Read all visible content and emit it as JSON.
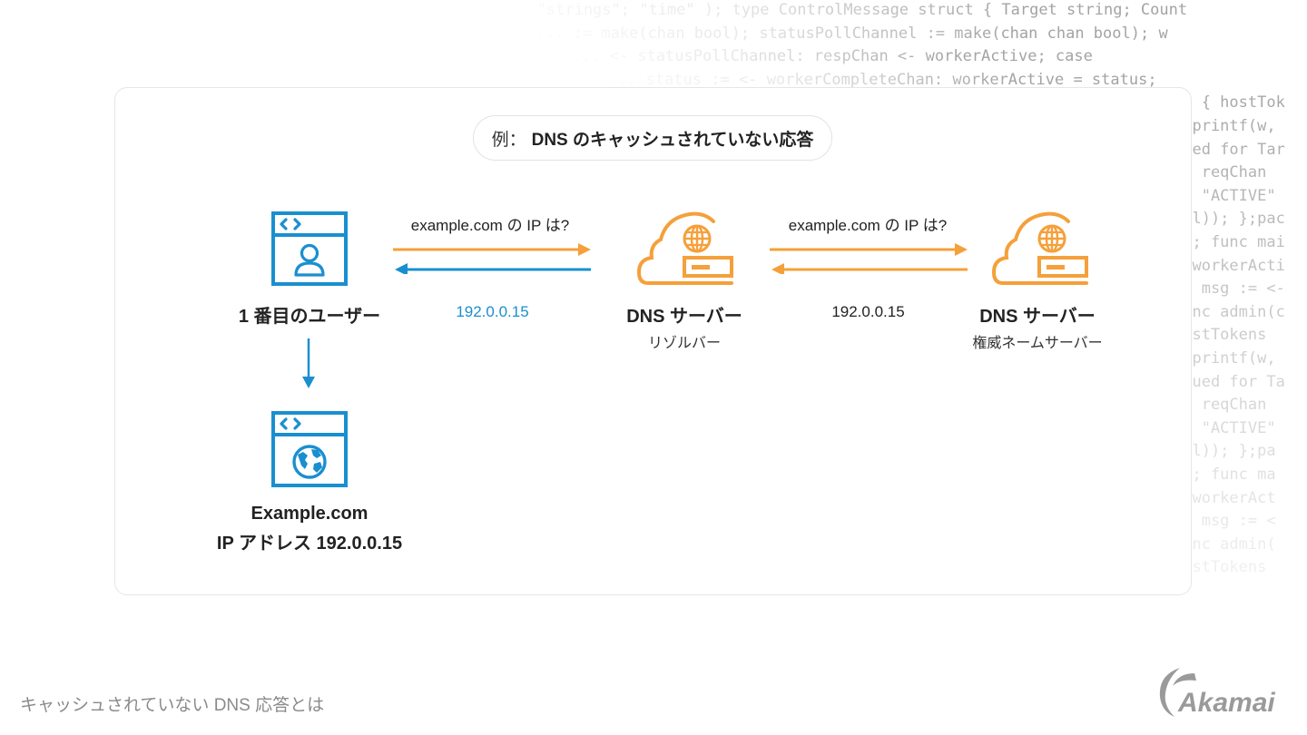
{
  "background_code": [
    "  ...  \"strings\"; \"time\" ); type ControlMessage struct { Target string; Count",
    "   ... := make(chan bool); statusPollChannel := make(chan chan bool); w",
    "   ... <- statusPollChannel: respChan <- workerActive; case",
    "   ... status := <- workerCompleteChan: workerActive = status;",
    "t) { hostTok",
    ".Fprintf(w,",
    "sued for Tar",
    " { reqChan",
    "w, \"ACTIVE\"",
    "nil)); };pac",
    " ); func mai",
    "; workerActi",
    "se msg := <-",
    "func admin(c",
    "hostTokens",
    ".Fprintf(w,",
    "ssued for Ta",
    " { reqChan",
    "w, \"ACTIVE\"",
    "nil)); };pa",
    " ); func ma",
    "; workerAct",
    "se msg := <",
    "func admin(",
    "hostTokens"
  ],
  "diagram": {
    "example_prefix": "例：",
    "example_title": "DNS のキャッシュされていない応答",
    "user": {
      "label": "1 番目のユーザー",
      "icon": "browser-user-icon"
    },
    "resolver": {
      "label": "DNS サーバー",
      "sublabel": "リゾルバー",
      "icon": "cloud-dns-server-icon"
    },
    "authoritative": {
      "label": "DNS サーバー",
      "sublabel": "権威ネームサーバー",
      "icon": "cloud-dns-server-icon"
    },
    "website": {
      "label_line1": "Example.com",
      "label_line2": "IP アドレス 192.0.0.15",
      "icon": "browser-globe-icon"
    },
    "query_user_to_resolver": "example.com の IP は?",
    "reply_resolver_to_user": "192.0.0.15",
    "query_resolver_to_auth": "example.com の IP は?",
    "reply_auth_to_resolver": "192.0.0.15"
  },
  "footer": {
    "title": "キャッシュされていない DNS 応答とは",
    "logo_text": "Akamai"
  },
  "colors": {
    "blue": "#1a8fd0",
    "orange": "#f5a03a",
    "text_dark": "#222222",
    "footer_gray": "#8a8a8a"
  }
}
